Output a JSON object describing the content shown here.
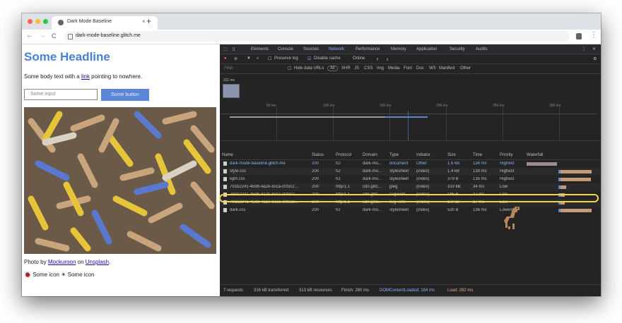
{
  "browser": {
    "tab_title": "Dark Mode Baseline",
    "tab_close": "×",
    "new_tab": "+",
    "url": "dark-mode-baseline.glitch.me",
    "back": "←",
    "forward": "→",
    "reload": "C",
    "menu": "⋮"
  },
  "page": {
    "headline": "Some Headline",
    "body_prefix": "Some body text with a ",
    "body_link": "link",
    "body_suffix": " pointing to nowhere.",
    "input_placeholder": "Some input",
    "button_label": "Some button",
    "caption_prefix": "Photo by ",
    "caption_author": "Mockuroon",
    "caption_mid": " on ",
    "caption_site": "Unsplash",
    "caption_end": ".",
    "icon_label_1": "Some icon",
    "icon_label_2": "Some icon"
  },
  "devtools": {
    "tabs": [
      "Elements",
      "Console",
      "Sources",
      "Network",
      "Performance",
      "Memory",
      "Application",
      "Security",
      "Audits"
    ],
    "active_tab": "Network",
    "toolbar": {
      "preserve_log": "Preserve log",
      "disable_cache": "Disable cache",
      "throttle": "Online"
    },
    "filter": {
      "placeholder": "Filter",
      "hide_data_urls": "Hide data URLs",
      "types": [
        "XHR",
        "JS",
        "CSS",
        "Img",
        "Media",
        "Font",
        "Doc",
        "WS",
        "Manifest",
        "Other"
      ]
    },
    "overview": {
      "thumb_time": "311 ms",
      "ticks": [
        "50 ms",
        "100 ms",
        "150 ms",
        "200 ms",
        "250 ms",
        "300 ms"
      ]
    },
    "columns": [
      "Name",
      "Status",
      "Protocol",
      "Domain",
      "Type",
      "Initiator",
      "Size",
      "Time",
      "Priority",
      "Waterfall"
    ],
    "rows": [
      {
        "name": "dark-mode-baseline.glitch.me",
        "status": "200",
        "protocol": "h2",
        "domain": "dark-mo...",
        "type": "document",
        "initiator": "Other",
        "size": "1.6 kB",
        "time": "134 ms",
        "priority": "Highest",
        "wf_start": 0.0,
        "wf_end": 0.43
      },
      {
        "name": "style.css",
        "status": "200",
        "protocol": "h2",
        "domain": "dark-mo...",
        "type": "stylesheet",
        "initiator": "(index)",
        "size": "1.4 kB",
        "time": "139 ms",
        "priority": "Highest",
        "wf_start": 0.45,
        "wf_end": 0.92
      },
      {
        "name": "light.css",
        "status": "200",
        "protocol": "h2",
        "domain": "dark-mo...",
        "type": "stylesheet",
        "initiator": "(index)",
        "size": "379 B",
        "time": "135 ms",
        "priority": "Highest",
        "wf_start": 0.45,
        "wf_end": 0.91
      },
      {
        "name": "791b2241-459b-4a2e-8cca-c0f3c2...",
        "status": "200",
        "protocol": "http/1.1",
        "domain": "cdn.glitc...",
        "type": "jpeg",
        "initiator": "(index)",
        "size": "310 kB",
        "time": "34 ms",
        "priority": "Low",
        "wf_start": 0.45,
        "wf_end": 0.56
      },
      {
        "name": "791b2241-459b-4a2e-8cca-c0f3c2...",
        "status": "200",
        "protocol": "http/1.1",
        "domain": "cdn.glitc...",
        "type": "svg+xml",
        "initiator": "(index)",
        "size": "185 B",
        "time": "27 ms",
        "priority": "Low",
        "wf_start": 0.45,
        "wf_end": 0.54
      },
      {
        "name": "791b2241-459b-4a2e-8cca-c0f3c2...",
        "status": "200",
        "protocol": "http/1.1",
        "domain": "cdn.glitc...",
        "type": "svg+xml",
        "initiator": "(index)",
        "size": "1.0 kB",
        "time": "27 ms",
        "priority": "Low",
        "wf_start": 0.45,
        "wf_end": 0.54
      },
      {
        "name": "dark.css",
        "status": "200",
        "protocol": "h2",
        "domain": "dark-mo...",
        "type": "stylesheet",
        "initiator": "(index)",
        "size": "530 B",
        "time": "136 ms",
        "priority": "Lowest",
        "wf_start": 0.45,
        "wf_end": 0.92
      }
    ],
    "status": {
      "requests": "7 requests",
      "transferred": "316 kB transferred",
      "resources": "313 kB resources",
      "finish": "Finish: 280 ms",
      "dcl": "DOMContentLoaded: 184 ms",
      "load": "Load: 282 ms"
    }
  },
  "colors": {
    "headline": "#4a7fd6",
    "button": "#5b86d8",
    "highlight": "#f5d547",
    "devtools_bg": "#242424",
    "link_blue": "#8ab4f8"
  }
}
